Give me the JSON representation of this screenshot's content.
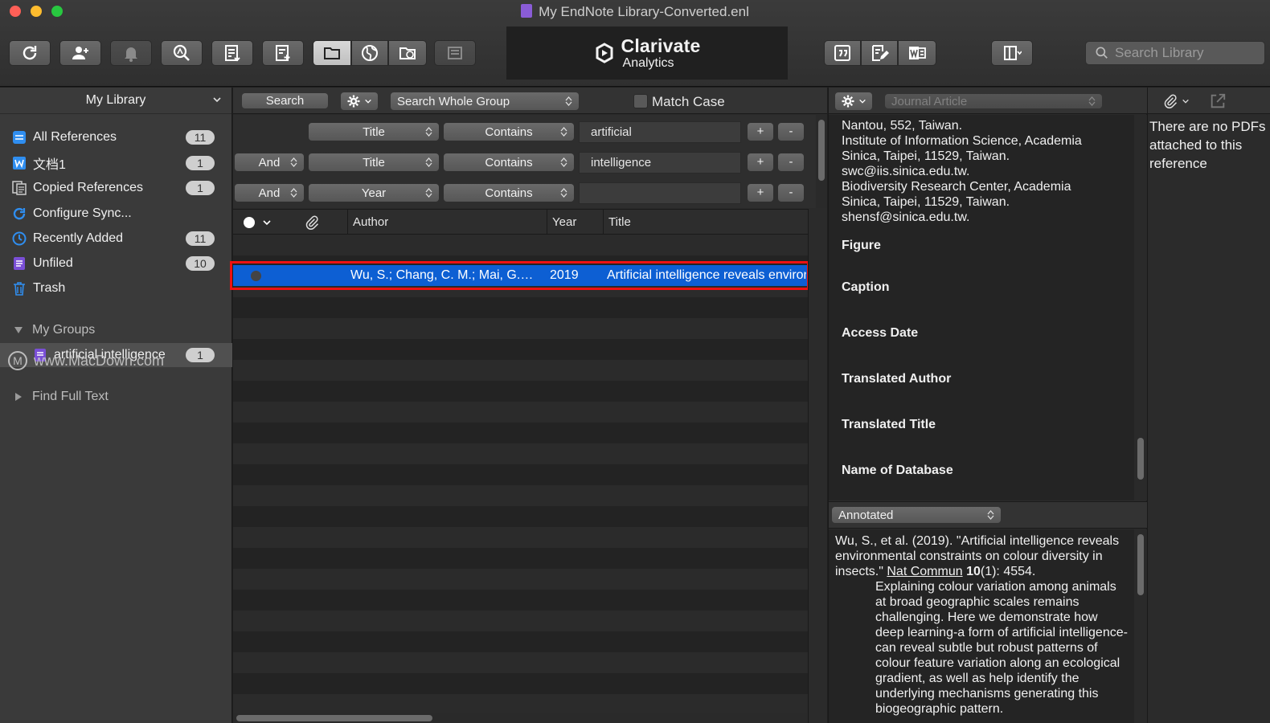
{
  "window": {
    "title": "My EndNote Library-Converted.enl"
  },
  "brand": {
    "name": "Clarivate",
    "sub": "Analytics"
  },
  "toolbar": {
    "icons": [
      "sync-icon",
      "add-user-icon",
      "bell-icon",
      "find-pdf-icon",
      "import-icon",
      "new-reference-icon",
      "local-library-icon",
      "online-icon",
      "online-local-icon",
      "group-icon",
      "insert-citation-icon",
      "edit-citation-icon",
      "word-icon",
      "layout-icon"
    ],
    "search_placeholder": "Search Library"
  },
  "sidebar": {
    "header": "My Library",
    "items": [
      {
        "label": "All References",
        "count": "11",
        "icon": "all-references-icon"
      },
      {
        "label": "文档1",
        "count": "1",
        "icon": "word-doc-icon"
      },
      {
        "label": "Copied References",
        "count": "1",
        "icon": "copied-icon"
      },
      {
        "label": "Configure Sync...",
        "count": "",
        "icon": "sync-icon"
      },
      {
        "label": "Recently Added",
        "count": "11",
        "icon": "recent-icon"
      },
      {
        "label": "Unfiled",
        "count": "10",
        "icon": "unfiled-icon"
      },
      {
        "label": "Trash",
        "count": "",
        "icon": "trash-icon"
      }
    ],
    "groups_label": "My Groups",
    "group": {
      "label": "artificial intelligence",
      "count": "1"
    },
    "find_full_text": "Find Full Text",
    "watermark": "www.MacDown.com"
  },
  "search": {
    "button": "Search",
    "scope": "Search Whole Group",
    "match_case": "Match Case",
    "rows": [
      {
        "connector": "",
        "field": "Title",
        "operator": "Contains",
        "value": "artificial"
      },
      {
        "connector": "And",
        "field": "Title",
        "operator": "Contains",
        "value": "intelligence"
      },
      {
        "connector": "And",
        "field": "Year",
        "operator": "Contains",
        "value": ""
      }
    ],
    "plus": "+",
    "minus": "-"
  },
  "list": {
    "columns": [
      "Author",
      "Year",
      "Title"
    ],
    "rows": [
      {
        "author": "Wu, S.; Chang, C. M.; Mai, G.…",
        "year": "2019",
        "title": "Artificial intelligence reveals environ"
      }
    ]
  },
  "reference": {
    "type": "Journal Article",
    "address_lines": [
      "Nantou, 552, Taiwan.",
      "Institute of Information Science, Academia",
      "Sinica, Taipei, 11529, Taiwan.",
      "swc@iis.sinica.edu.tw.",
      "Biodiversity Research Center, Academia",
      "Sinica, Taipei, 11529, Taiwan.",
      "shensf@sinica.edu.tw."
    ],
    "fields": [
      "Figure",
      "Caption",
      "Access Date",
      "Translated Author",
      "Translated Title",
      "Name of Database"
    ]
  },
  "preview": {
    "style": "Annotated",
    "citation_lead": "Wu, S., et al. (2019). \"Artificial intelligence reveals environmental constraints on colour diversity in insects.\" ",
    "journal": "Nat Commun",
    "volume": "10",
    "issue_pages": "(1): 4554.",
    "abstract": "Explaining colour variation among animals at broad geographic scales remains challenging. Here we demonstrate how deep learning-a form of artificial intelligence-can reveal subtle but robust patterns of colour feature variation along an ecological gradient, as well as help identify the underlying mechanisms generating this biogeographic pattern."
  },
  "pdf": {
    "message": "There are no PDFs attached to this reference"
  }
}
